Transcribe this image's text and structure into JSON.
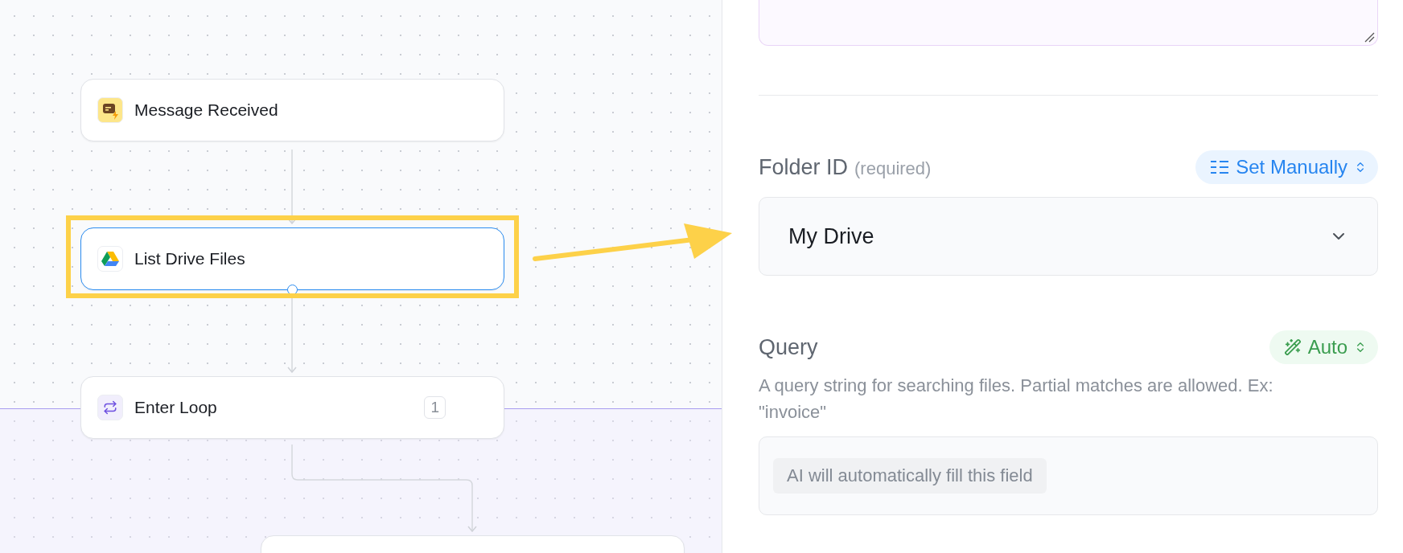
{
  "canvas": {
    "nodes": [
      {
        "kind": "trigger",
        "label": "Message Received",
        "selected": false
      },
      {
        "kind": "drive",
        "label": "List Drive Files",
        "selected": true
      },
      {
        "kind": "loop",
        "label": "Enter Loop",
        "badge": "1",
        "selected": false
      },
      {
        "kind": "step",
        "selected": false
      }
    ]
  },
  "panel": {
    "fields": [
      {
        "label": "Folder ID",
        "note": "(required)",
        "mode": {
          "kind": "manual",
          "label": "Set Manually"
        },
        "input": {
          "kind": "select",
          "value": "My Drive"
        }
      },
      {
        "label": "Query",
        "mode": {
          "kind": "auto",
          "label": "Auto"
        },
        "description": "A query string for searching files. Partial matches are allowed. Ex: \"invoice\"",
        "input": {
          "kind": "auto",
          "chip": "AI will automatically fill this field"
        }
      }
    ]
  }
}
